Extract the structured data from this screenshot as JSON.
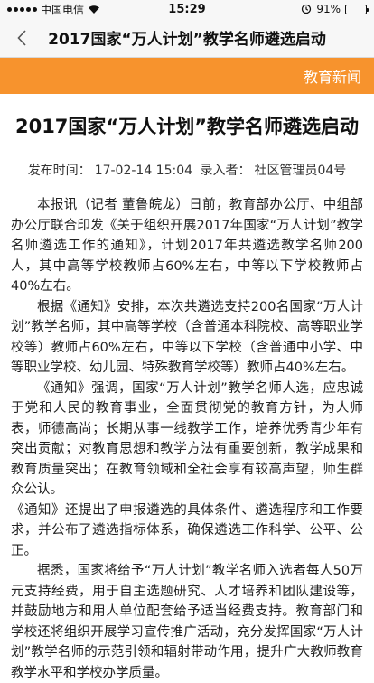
{
  "status": {
    "carrier": "中国电信",
    "time": "15:29",
    "battery": "91%",
    "battery_level": 0.91
  },
  "nav": {
    "title": "2017国家“万人计划”教学名师遴选启动"
  },
  "banner": {
    "label": "教育新闻"
  },
  "article": {
    "title": "2017国家“万人计划”教学名师遴选启动",
    "publish_label": "发布时间：",
    "publish_time": "17-02-14 15:04",
    "author_label": "录入者：",
    "author": "社区管理员04号",
    "paragraphs": [
      "本报讯（记者 董鲁皖龙）日前，教育部办公厅、中组部办公厅联合印发《关于组织开展2017年国家“万人计划”教学名师遴选工作的通知》，计划2017年共遴选教学名师200人，其中高等学校教师占60%左右，中等以下学校教师占40%左右。",
      "根据《通知》安排，本次共遴选支持200名国家“万人计划”教学名师，其中高等学校（含普通本科院校、高等职业学校等）教师占60%左右，中等以下学校（含普通中小学、中等职业学校、幼儿园、特殊教育学校等）教师占40%左右。",
      "《通知》强调，国家“万人计划”教学名师人选，应忠诚于党和人民的教育事业，全面贯彻党的教育方针，为人师表，师德高尚；长期从事一线教学工作，培养优秀青少年有突出贡献；对教育思想和教学方法有重要创新，教学成果和教育质量突出；在教育领域和全社会享有较高声望，师生群众公认。",
      "《通知》还提出了申报遴选的具体条件、遴选程序和工作要求，并公布了遴选指标体系，确保遴选工作科学、公平、公正。",
      "据悉，国家将给予“万人计划”教学名师入选者每人50万元支持经费，用于自主选题研究、人才培养和团队建设等，并鼓励地方和用人单位配套给予适当经费支持。教育部门和学校还将组织开展学习宣传推广活动，充分发挥国家“万人计划”教学名师的示范引领和辐射带动作用，提升广大教师教育教学水平和学校办学质量。"
    ]
  }
}
